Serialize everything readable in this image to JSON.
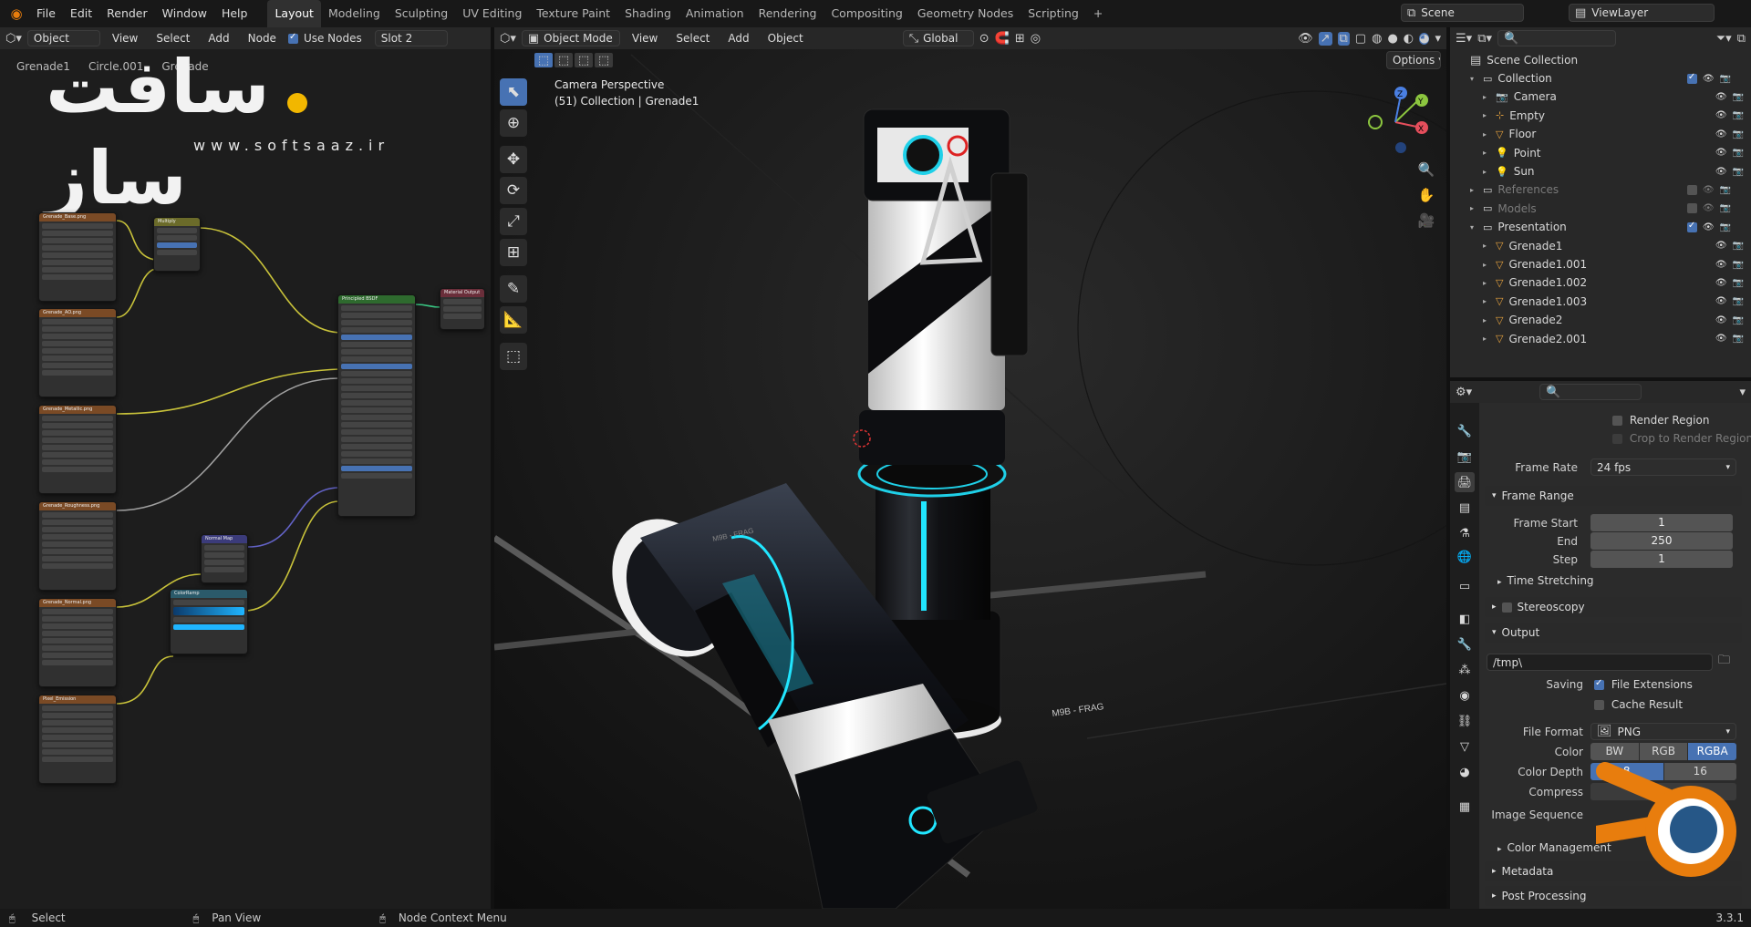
{
  "menus": [
    "File",
    "Edit",
    "Render",
    "Window",
    "Help"
  ],
  "workspaces": [
    "Layout",
    "Modeling",
    "Sculpting",
    "UV Editing",
    "Texture Paint",
    "Shading",
    "Animation",
    "Rendering",
    "Compositing",
    "Geometry Nodes",
    "Scripting"
  ],
  "active_workspace": "Layout",
  "add_workspace": "+",
  "scene": {
    "name": "Scene",
    "view_layer": "ViewLayer"
  },
  "node_editor": {
    "object_mode": "Object",
    "menus": [
      "View",
      "Select",
      "Add",
      "Node"
    ],
    "use_nodes_label": "Use Nodes",
    "slot": "Slot 2",
    "breadcrumb": [
      "Grenade1",
      "Circle.001",
      "Grenade"
    ],
    "watermark_url": "www.softsaaz.ir",
    "watermark_logo_text": "سافت ساز",
    "nodes": [
      {
        "title": "Grenade_Base.png",
        "color": "#7a4a25"
      },
      {
        "title": "Multiply",
        "color": "#6b6b2a"
      },
      {
        "title": "Grenade_AO.png",
        "color": "#7a4a25"
      },
      {
        "title": "Grenade_Metallic.png",
        "color": "#7a4a25"
      },
      {
        "title": "Grenade_Roughness.png",
        "color": "#7a4a25"
      },
      {
        "title": "Normal Map",
        "color": "#3b3b7a"
      },
      {
        "title": "Grenade_Normal.png",
        "color": "#7a4a25"
      },
      {
        "title": "ColorRamp",
        "color": "#2b5a6a"
      },
      {
        "title": "Pixel_Emission",
        "color": "#7a4a25"
      },
      {
        "title": "Principled BSDF",
        "color": "#2e6a2e"
      },
      {
        "title": "Material Output",
        "color": "#6a2e3a"
      }
    ]
  },
  "viewport": {
    "mode": "Object Mode",
    "menus": [
      "View",
      "Select",
      "Add",
      "Object"
    ],
    "transform": "Global",
    "options_label": "Options",
    "camera_label": "Camera Perspective",
    "collection_label": "(51) Collection | Grenade1",
    "text_on_model_1": "M9B - FRAG",
    "text_on_model_2": "M9B - FRAG",
    "gizmo": {
      "z": "Z",
      "y": "Y",
      "x": "X"
    }
  },
  "outliner": {
    "root": "Scene Collection",
    "items": [
      {
        "label": "Collection",
        "indent": 1,
        "icon": "collection",
        "checked": true
      },
      {
        "label": "Camera",
        "indent": 2,
        "icon": "camera",
        "checked": false
      },
      {
        "label": "Empty",
        "indent": 2,
        "icon": "empty",
        "checked": false
      },
      {
        "label": "Floor",
        "indent": 2,
        "icon": "mesh",
        "checked": false
      },
      {
        "label": "Point",
        "indent": 2,
        "icon": "light",
        "checked": false
      },
      {
        "label": "Sun",
        "indent": 2,
        "icon": "light",
        "checked": false
      },
      {
        "label": "References",
        "indent": 1,
        "icon": "collection",
        "checked": false,
        "dim": true
      },
      {
        "label": "Models",
        "indent": 1,
        "icon": "collection",
        "checked": false,
        "dim": true
      },
      {
        "label": "Presentation",
        "indent": 1,
        "icon": "collection",
        "checked": true
      },
      {
        "label": "Grenade1",
        "indent": 2,
        "icon": "mesh",
        "checked": false
      },
      {
        "label": "Grenade1.001",
        "indent": 2,
        "icon": "mesh",
        "checked": false
      },
      {
        "label": "Grenade1.002",
        "indent": 2,
        "icon": "mesh",
        "checked": false
      },
      {
        "label": "Grenade1.003",
        "indent": 2,
        "icon": "mesh",
        "checked": false
      },
      {
        "label": "Grenade2",
        "indent": 2,
        "icon": "mesh",
        "checked": false
      },
      {
        "label": "Grenade2.001",
        "indent": 2,
        "icon": "mesh",
        "checked": false
      }
    ]
  },
  "properties": {
    "render_region": "Render Region",
    "crop_region": "Crop to Render Region",
    "frame_rate_label": "Frame Rate",
    "frame_rate": "24 fps",
    "frame_range": "Frame Range",
    "frame_start_label": "Frame Start",
    "frame_start": "1",
    "end_label": "End",
    "end": "250",
    "step_label": "Step",
    "step": "1",
    "time_stretching": "Time Stretching",
    "stereoscopy": "Stereoscopy",
    "output": "Output",
    "path": "/tmp\\",
    "saving_label": "Saving",
    "file_extensions": "File Extensions",
    "cache_result": "Cache Result",
    "file_format_label": "File Format",
    "file_format": "PNG",
    "color_label": "Color",
    "color_modes": [
      "BW",
      "RGB",
      "RGBA"
    ],
    "active_color_mode": "RGBA",
    "color_depth_label": "Color Depth",
    "color_depths": [
      "8",
      "16"
    ],
    "compression_label": "Compress",
    "image_sequence_label": "Image Sequence",
    "color_management": "Color Management",
    "metadata": "Metadata",
    "post_processing": "Post Processing"
  },
  "statusbar": {
    "select": "Select",
    "pan": "Pan View",
    "context": "Node Context Menu",
    "version": "3.3.1"
  },
  "colors": {
    "accent": "#4772b3",
    "blender_orange": "#e87d0d",
    "blender_blue": "#265787"
  }
}
